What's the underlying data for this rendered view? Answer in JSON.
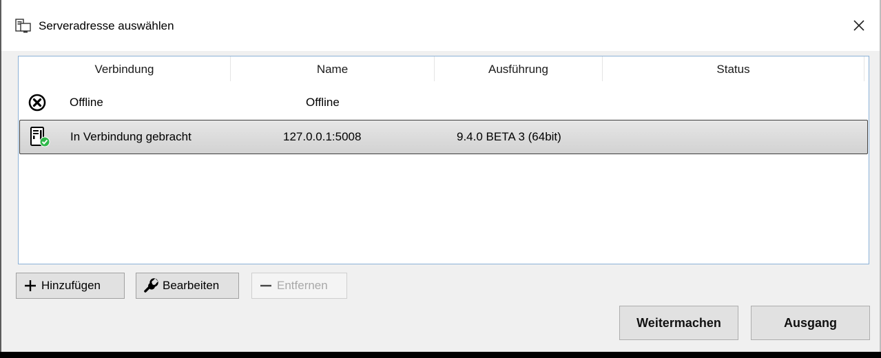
{
  "window": {
    "title": "Serveradresse auswählen"
  },
  "list": {
    "columns": [
      "Verbindung",
      "Name",
      "Ausführung",
      "Status"
    ],
    "rows": [
      {
        "icon": "offline-x-icon",
        "connection": "Offline",
        "name": "Offline",
        "version": "",
        "status": ""
      },
      {
        "icon": "server-connected-icon",
        "connection": "In Verbindung gebracht",
        "name": "127.0.0.1:5008",
        "version": "9.4.0 BETA 3 (64bit)",
        "status": "",
        "selected": true
      }
    ]
  },
  "toolbar": {
    "add_label": "Hinzufügen",
    "edit_label": "Bearbeiten",
    "remove_label": "Entfernen",
    "remove_enabled": false
  },
  "footer": {
    "continue_label": "Weitermachen",
    "exit_label": "Ausgang"
  },
  "colors": {
    "list_border": "#8ab0d6",
    "status_ok": "#2fb84a"
  }
}
